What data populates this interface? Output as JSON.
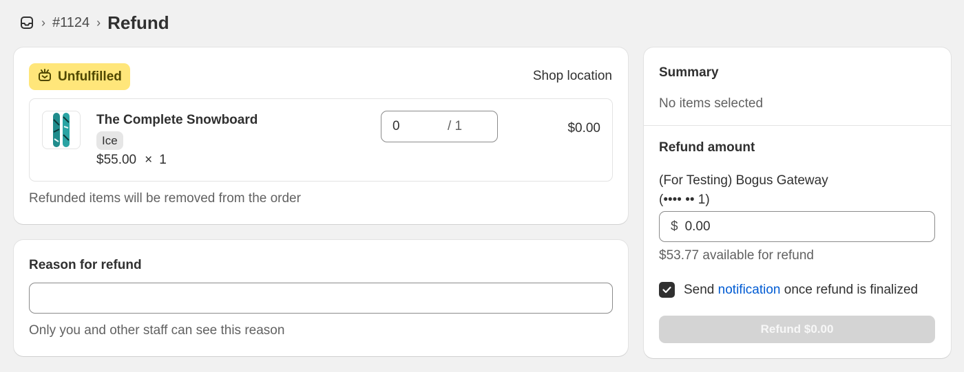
{
  "breadcrumb": {
    "home_icon": "inbox-icon",
    "order_number": "#1124",
    "separator": "›",
    "title": "Refund"
  },
  "items_card": {
    "status_badge": "Unfulfilled",
    "status_icon": "package-icon",
    "location": "Shop location",
    "product": {
      "name": "The Complete Snowboard",
      "variant": "Ice",
      "unit_price": "$55.00",
      "multiply": "×",
      "quantity": "1",
      "refund_qty_value": "0",
      "refund_qty_max": "/ 1",
      "line_total": "$0.00"
    },
    "note": "Refunded items will be removed from the order"
  },
  "reason_card": {
    "title": "Reason for refund",
    "input_value": "",
    "help_text": "Only you and other staff can see this reason"
  },
  "summary": {
    "title": "Summary",
    "selection_status": "No items selected",
    "refund_amount_title": "Refund amount",
    "gateway_line1": "(For Testing) Bogus Gateway",
    "gateway_line2": "(•••• •• 1)",
    "currency_symbol": "$",
    "amount_value": "0.00",
    "available_text": "$53.77 available for refund",
    "notify_prefix": "Send",
    "notify_link": "notification",
    "notify_suffix": "once refund is finalized",
    "notify_checked": true,
    "refund_button": "Refund $0.00"
  },
  "colors": {
    "badge_bg": "#ffe67a",
    "link": "#005bd3",
    "button_disabled_bg": "#d4d4d4"
  }
}
